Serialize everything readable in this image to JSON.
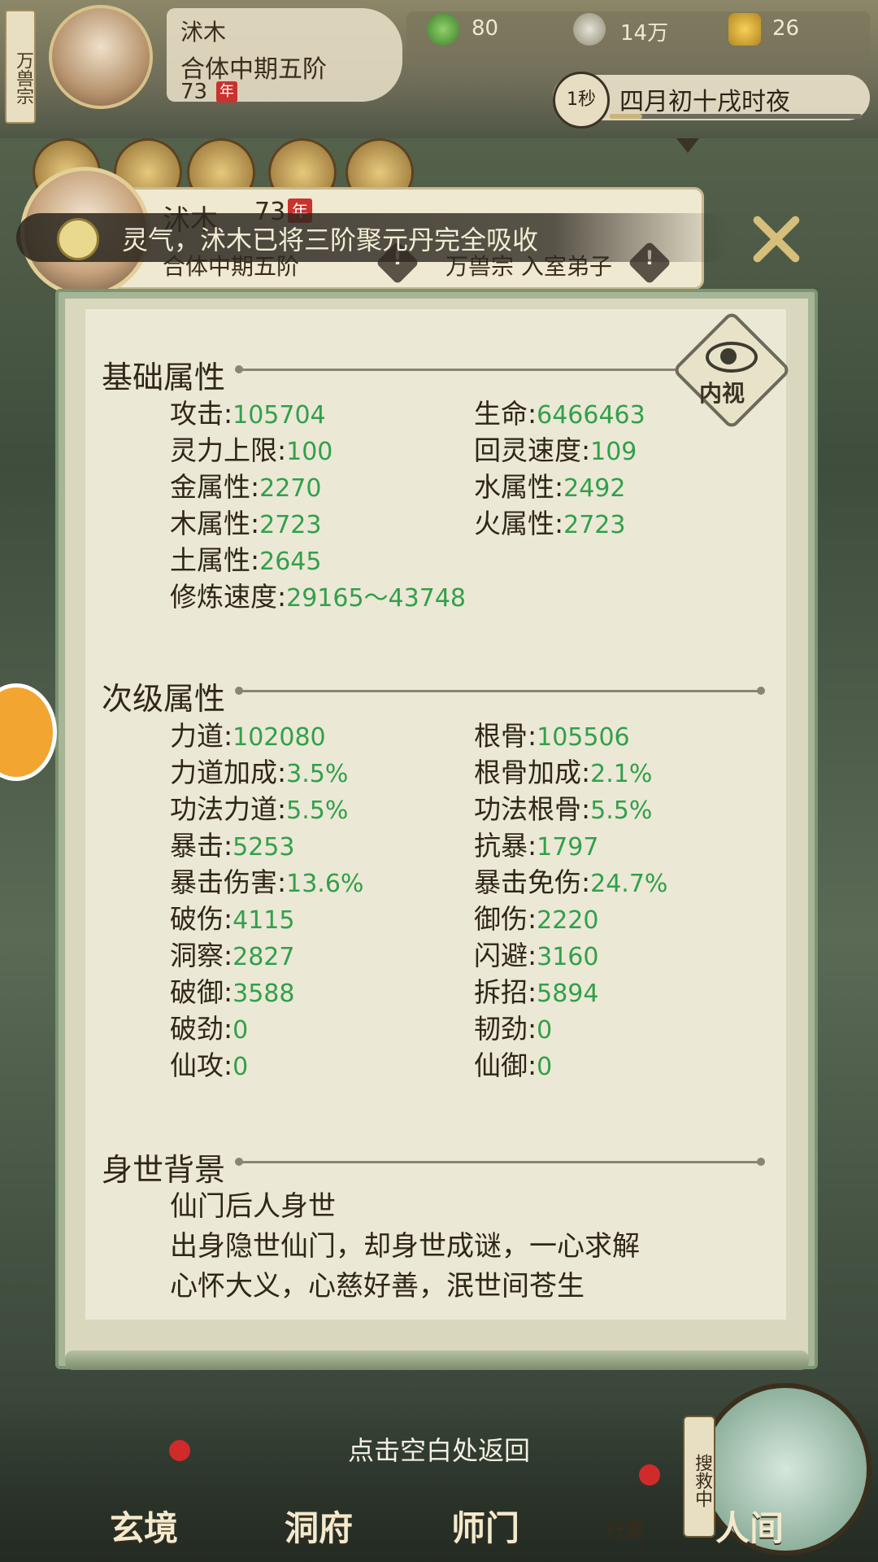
{
  "top_hud": {
    "sect_tag": "万兽宗",
    "name": "沭木",
    "realm": "合体中期五阶",
    "age": "73",
    "age_unit": "年",
    "resources": [
      {
        "icon": "jade-leaf-icon",
        "value": "80"
      },
      {
        "icon": "coin-icon",
        "value": "14万"
      },
      {
        "icon": "gold-ingot-icon",
        "value": "26"
      }
    ],
    "time_speed": "1秒",
    "date_text": "四月初十戌时夜"
  },
  "character": {
    "name": "沭木",
    "age": "73",
    "age_unit": "年",
    "realm": "合体中期五阶",
    "sect": "万兽宗 入室弟子"
  },
  "notification": "灵气，沭木已将三阶聚元丹完全吸收",
  "inner_view_label": "内视",
  "sections": {
    "basic": {
      "title": "基础属性",
      "attrs": [
        {
          "label": "攻击",
          "value": "105704"
        },
        {
          "label": "生命",
          "value": "6466463"
        },
        {
          "label": "灵力上限",
          "value": "100"
        },
        {
          "label": "回灵速度",
          "value": "109"
        },
        {
          "label": "金属性",
          "value": "2270"
        },
        {
          "label": "水属性",
          "value": "2492"
        },
        {
          "label": "木属性",
          "value": "2723"
        },
        {
          "label": "火属性",
          "value": "2723"
        },
        {
          "label": "土属性",
          "value": "2645"
        },
        {
          "label": "修炼速度",
          "value": "29165～43748"
        }
      ]
    },
    "secondary": {
      "title": "次级属性",
      "attrs": [
        {
          "label": "力道",
          "value": "102080"
        },
        {
          "label": "根骨",
          "value": "105506"
        },
        {
          "label": "力道加成",
          "value": "3.5%"
        },
        {
          "label": "根骨加成",
          "value": "2.1%"
        },
        {
          "label": "功法力道",
          "value": "5.5%"
        },
        {
          "label": "功法根骨",
          "value": "5.5%"
        },
        {
          "label": "暴击",
          "value": "5253"
        },
        {
          "label": "抗暴",
          "value": "1797"
        },
        {
          "label": "暴击伤害",
          "value": "13.6%"
        },
        {
          "label": "暴击免伤",
          "value": "24.7%"
        },
        {
          "label": "破伤",
          "value": "4115"
        },
        {
          "label": "御伤",
          "value": "2220"
        },
        {
          "label": "洞察",
          "value": "2827"
        },
        {
          "label": "闪避",
          "value": "3160"
        },
        {
          "label": "破御",
          "value": "3588"
        },
        {
          "label": "拆招",
          "value": "5894"
        },
        {
          "label": "破劲",
          "value": "0"
        },
        {
          "label": "韧劲",
          "value": "0"
        },
        {
          "label": "仙攻",
          "value": "0"
        },
        {
          "label": "仙御",
          "value": "0"
        }
      ]
    },
    "background": {
      "title": "身世背景",
      "lines": [
        "仙门后人身世",
        "出身隐世仙门，却身世成谜，一心求解",
        "心怀大义，心慈好善，泯世间苍生"
      ]
    }
  },
  "back_hint": "点击空白处返回",
  "bottom_nav": {
    "items": [
      "玄境",
      "洞府",
      "师门",
      "行囊",
      "人间"
    ],
    "search_tag": "搜救中"
  }
}
